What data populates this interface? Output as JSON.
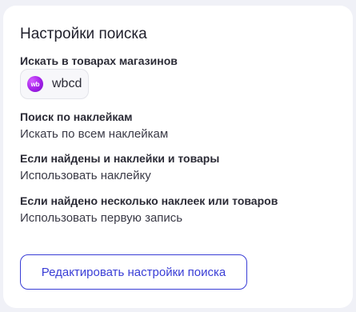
{
  "settings": {
    "title": "Настройки поиска",
    "store_search": {
      "label": "Искать в товарах магазинов",
      "store": {
        "logo_text": "wb",
        "name": "wbcd",
        "logo_color": "#a31fe8"
      }
    },
    "sticker_search": {
      "label": "Поиск по наклейкам",
      "value": "Искать по всем наклейкам"
    },
    "found_both": {
      "label": "Если найдены и наклейки и товары",
      "value": "Использовать наклейку"
    },
    "found_multiple": {
      "label": "Если найдено несколько наклеек или товаров",
      "value": "Использовать первую запись"
    },
    "edit_button_label": "Редактировать настройки поиска",
    "accent_color": "#3a3ed6"
  }
}
